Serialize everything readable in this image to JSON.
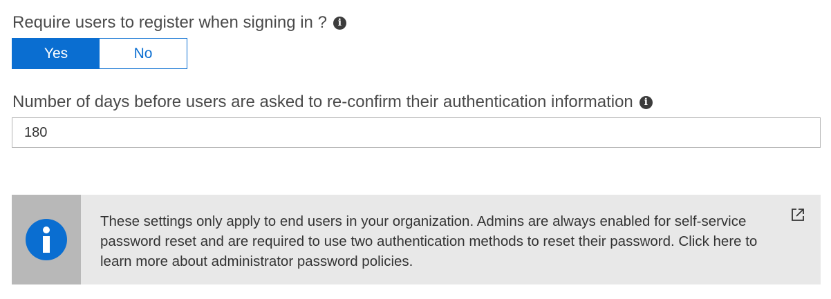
{
  "register_setting": {
    "label": "Require users to register when signing in ?",
    "options": [
      "Yes",
      "No"
    ],
    "selected": "Yes"
  },
  "reconfirm_setting": {
    "label": "Number of days before users are asked to re-confirm their authentication information",
    "value": "180"
  },
  "info_banner": {
    "text": "These settings only apply to end users in your organization. Admins are always enabled for self-service password reset and are required to use two authentication methods to reset their password. Click here to learn more about administrator password policies.",
    "icon": "info-icon",
    "link_icon": "external-link-icon"
  },
  "colors": {
    "accent": "#0a6ed1",
    "banner_bg": "#e8e8e8",
    "banner_side": "#b8b8b8"
  }
}
